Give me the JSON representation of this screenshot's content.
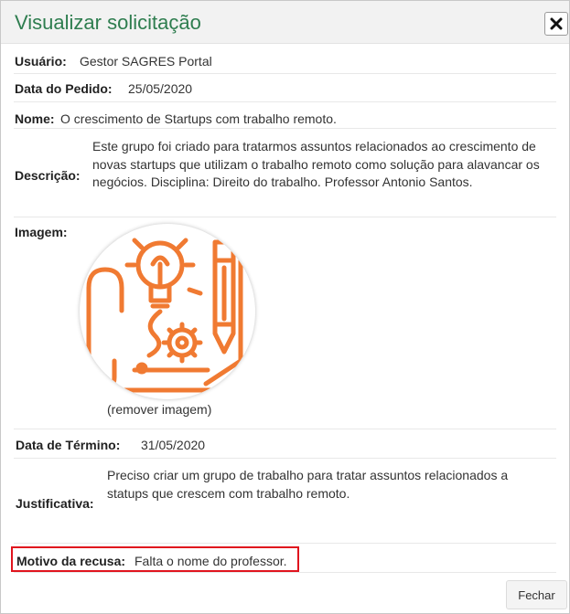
{
  "dialog": {
    "title": "Visualizar solicitação",
    "close_icon": "close-icon"
  },
  "fields": {
    "user_label": "Usuário:",
    "user_value": "Gestor SAGRES Portal",
    "date_label": "Data do Pedido:",
    "date_value": "25/05/2020",
    "name_label": "Nome:",
    "name_value": "O crescimento de Startups com trabalho remoto.",
    "desc_label": "Descrição:",
    "desc_value": "Este grupo foi criado para tratarmos assuntos relacionados ao crescimento de novas startups que utilizam o trabalho remoto como solução para alavancar os negócios. Disciplina: Direito do trabalho. Professor Antonio Santos.",
    "image_label": "Imagem:",
    "remove_image": "(remover imagem)",
    "end_label": "Data de Término:",
    "end_value": "31/05/2020",
    "just_label": "Justificativa:",
    "just_value": "Preciso criar um grupo de trabalho para tratar assuntos relacionados a statups que crescem com trabalho remoto.",
    "refusal_label": "Motivo da recusa:",
    "refusal_value": "Falta o nome do professor."
  },
  "footer": {
    "close_label": "Fechar"
  },
  "colors": {
    "title_green": "#2e7d4f",
    "icon_orange": "#f07a32",
    "highlight_red": "#e0141e"
  },
  "image_icon": "startup-idea-icon"
}
